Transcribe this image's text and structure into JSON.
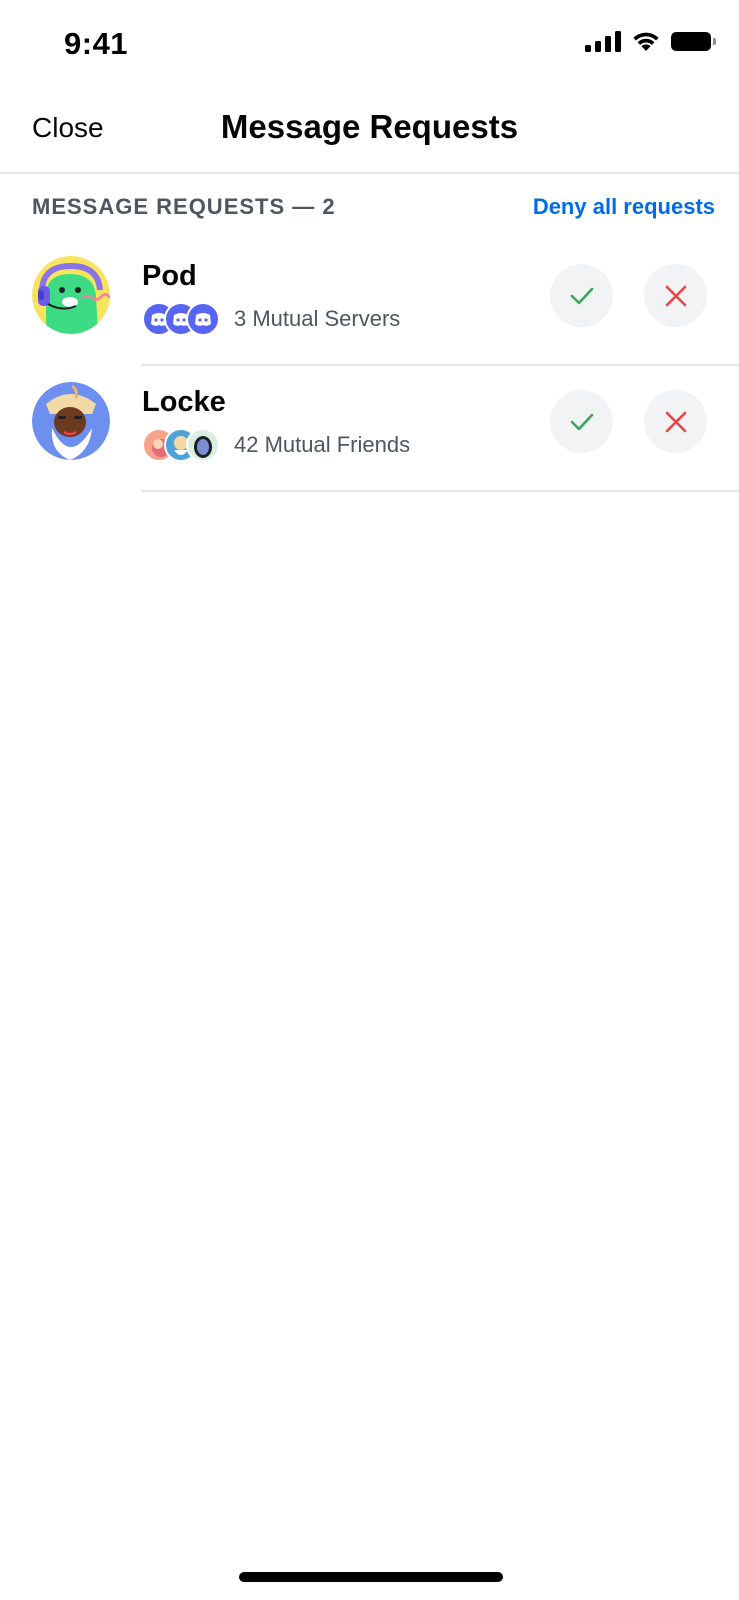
{
  "status_bar": {
    "time": "9:41"
  },
  "header": {
    "close_label": "Close",
    "title": "Message Requests"
  },
  "section": {
    "label": "MESSAGE REQUESTS — 2",
    "deny_all_label": "Deny all requests"
  },
  "requests": [
    {
      "name": "Pod",
      "mutual_text": "3 Mutual Servers",
      "mutual_type": "servers",
      "avatar": "green-alien-headset-avatar"
    },
    {
      "name": "Locke",
      "mutual_text": "42 Mutual Friends",
      "mutual_type": "friends",
      "avatar": "bearded-character-avatar"
    }
  ],
  "colors": {
    "accent_link": "#006ce7",
    "accept_icon": "#3ba55c",
    "deny_icon": "#ed4245",
    "blurple": "#5865f2",
    "button_bg": "#f2f3f5",
    "muted_text": "#4f5660",
    "divider": "#e3e5e8"
  }
}
